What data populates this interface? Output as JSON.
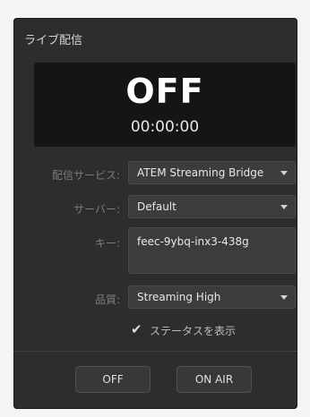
{
  "window": {
    "title": "ライブ配信"
  },
  "display": {
    "status": "OFF",
    "timer": "00:00:00"
  },
  "form": {
    "service_label": "配信サービス:",
    "service_value": "ATEM Streaming Bridge",
    "server_label": "サーバー:",
    "server_value": "Default",
    "key_label": "キー:",
    "key_value": "feec-9ybq-inx3-438g",
    "quality_label": "品質:",
    "quality_value": "Streaming High",
    "show_status_label": "ステータスを表示",
    "show_status_checked": true
  },
  "buttons": {
    "off_label": "OFF",
    "on_air_label": "ON AIR"
  },
  "colors": {
    "panel_bg": "#2d2d2d",
    "display_bg": "#151515",
    "control_bg": "#3c3c3c"
  },
  "icons": {
    "dropdown": "chevron-down-icon",
    "check": "checkmark-icon"
  }
}
